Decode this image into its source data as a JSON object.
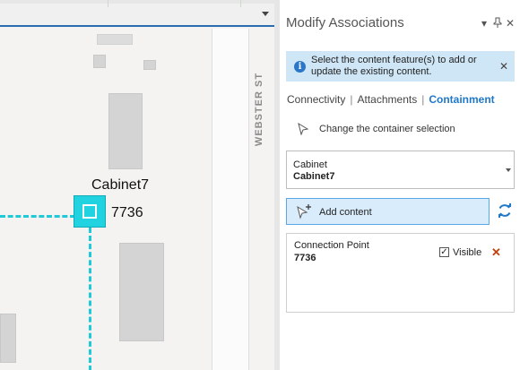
{
  "map": {
    "street_label": "WEBSTER ST",
    "feature_label_name": "Cabinet7",
    "feature_label_id": "7736",
    "symbol_color": "#21d3e0",
    "line_color": "#1ec9d8"
  },
  "pane": {
    "title": "Modify Associations",
    "pin_icon": "pin-icon",
    "menu_icon": "chevron-down-icon",
    "close_icon": "close-icon",
    "info": {
      "text": "Select the content feature(s) to add or update the existing content.",
      "icon": "info-icon"
    },
    "tabs": [
      {
        "label": "Connectivity",
        "active": false
      },
      {
        "label": "Attachments",
        "active": false
      },
      {
        "label": "Containment",
        "active": true
      }
    ],
    "change_selection_label": "Change the container selection",
    "container": {
      "layer": "Cabinet",
      "value": "Cabinet7"
    },
    "add_content_label": "Add content",
    "content_items": [
      {
        "layer": "Connection Point",
        "id": "7736",
        "visible_label": "Visible",
        "visible_checked": true
      }
    ],
    "accent_color": "#1f78c8"
  }
}
